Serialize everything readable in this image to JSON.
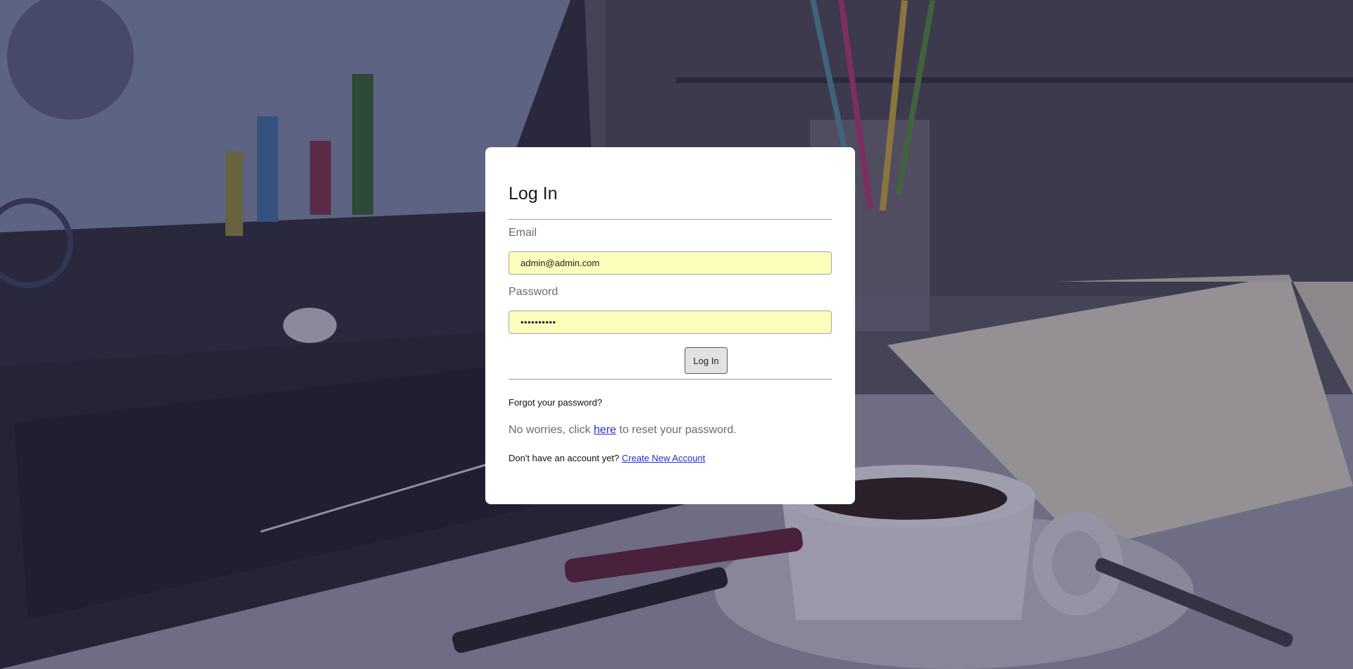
{
  "login": {
    "title": "Log In",
    "email_label": "Email",
    "email_value": "admin@admin.com",
    "password_label": "Password",
    "password_value": "••••••••••",
    "submit_label": "Log In",
    "forgot_title": "Forgot your password?",
    "reset_prefix": "No worries, click ",
    "reset_link": "here",
    "reset_suffix": " to reset your password.",
    "signup_prefix": "Don't have an account yet? ",
    "signup_link": "Create New Account"
  },
  "colors": {
    "input_background": "#fbfdbb",
    "link": "#2a2ad6",
    "card": "#ffffff"
  }
}
